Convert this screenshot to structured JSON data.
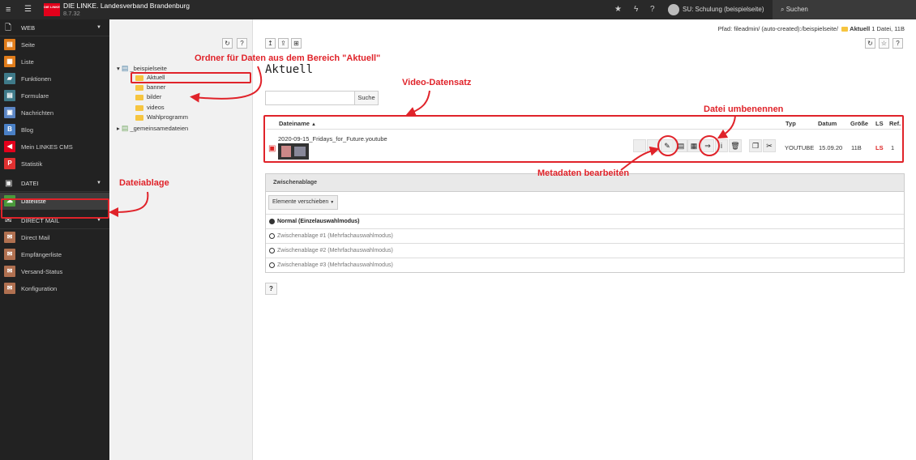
{
  "topbar": {
    "brand_name": "DIE LINKE. Landesverband Brandenburg",
    "version": "8.7.32",
    "logo_text": "DIE LINKE",
    "user": "SU: Schulung (beispielseite)",
    "search_label": "Suchen",
    "icons": [
      "menu-icon",
      "module-list-icon",
      "bookmark-star-icon",
      "flash-icon",
      "help-icon",
      "user-avatar-icon",
      "search-icon"
    ]
  },
  "sidebar": {
    "web": {
      "label": "WEB",
      "items": [
        {
          "label": "Seite",
          "icon": "page-icon",
          "color": "#e07c1a"
        },
        {
          "label": "Liste",
          "icon": "list-icon",
          "color": "#e07c1a"
        },
        {
          "label": "Funktionen",
          "icon": "functions-icon",
          "color": "#3f7a89"
        },
        {
          "label": "Formulare",
          "icon": "forms-icon",
          "color": "#3f7a89"
        },
        {
          "label": "Nachrichten",
          "icon": "news-icon",
          "color": "#5b85c4"
        },
        {
          "label": "Blog",
          "icon": "blog-icon",
          "color": "#4a80c6"
        },
        {
          "label": "Mein LINKES CMS",
          "icon": "cms-icon",
          "color": "#e3001b"
        },
        {
          "label": "Statistik",
          "icon": "statistics-icon",
          "color": "#e03030"
        }
      ]
    },
    "datei": {
      "label": "DATEI",
      "items": [
        {
          "label": "Dateiliste",
          "icon": "filelist-icon",
          "color": "#4a9a3b"
        }
      ]
    },
    "directmail": {
      "label": "DIRECT MAIL",
      "items": [
        {
          "label": "Direct Mail",
          "icon": "mail-icon",
          "color": "#b07050"
        },
        {
          "label": "Empfängerliste",
          "icon": "recipients-icon",
          "color": "#b07050"
        },
        {
          "label": "Versand-Status",
          "icon": "dispatch-status-icon",
          "color": "#b07050"
        },
        {
          "label": "Konfiguration",
          "icon": "config-icon",
          "color": "#b07050"
        }
      ]
    }
  },
  "tree": {
    "root": "_beispielseite",
    "children": [
      "Aktuell",
      "banner",
      "bilder",
      "videos",
      "Wahlprogramm"
    ],
    "root2": "_gemeinsamedateien"
  },
  "main": {
    "path_label": "Pfad: fileadmin/ (auto-created):/beispielseite/",
    "path_current": "Aktuell",
    "path_info": "1 Datei, 11B",
    "title": "Aktuell",
    "search_button": "Suche",
    "columns": {
      "name": "Dateiname",
      "type": "Typ",
      "date": "Datum",
      "size": "Größe",
      "ls": "LS",
      "ref": "Ref."
    },
    "file": {
      "name": "2020-09-15_Fridays_for_Future.youtube",
      "type": "YOUTUBE",
      "date": "15.09.20",
      "size": "11B",
      "ls": "LS",
      "ref": "1"
    },
    "clipboard": {
      "title": "Zwischenablage",
      "dropdown": "Elemente verschieben",
      "modes": [
        "Normal (Einzelauswahlmodus)",
        "Zwischenablage #1 (Mehrfachauswahlmodus)",
        "Zwischenablage #2 (Mehrfachauswahlmodus)",
        "Zwischenablage #3 (Mehrfachauswahlmodus)"
      ]
    },
    "help": "?"
  },
  "annotations": {
    "folder": "Ordner für Daten aus dem Bereich \"Aktuell\"",
    "video": "Video-Datensatz",
    "rename": "Datei umbenennen",
    "metadata": "Metadaten bearbeiten",
    "storage": "Dateiablage"
  },
  "colors": {
    "annotation": "#e0232a",
    "topbar": "#292929",
    "sidebar": "#222222"
  }
}
